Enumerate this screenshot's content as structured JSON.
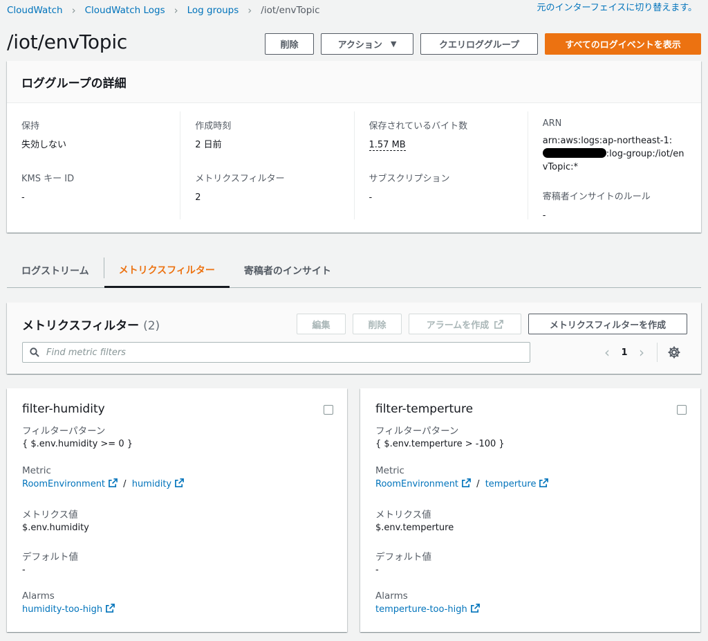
{
  "breadcrumb": {
    "items": [
      "CloudWatch",
      "CloudWatch Logs",
      "Log groups"
    ],
    "current": "/iot/envTopic"
  },
  "switch_ui_link": "元のインターフェイスに切り替えます。",
  "header": {
    "title": "/iot/envTopic",
    "delete_btn": "削除",
    "actions_btn": "アクション",
    "query_btn": "クエリロググループ",
    "view_all_btn": "すべてのログイベントを表示"
  },
  "details": {
    "title": "ロググループの詳細",
    "retention_label": "保持",
    "retention_value": "失効しない",
    "kms_label": "KMS キー ID",
    "kms_value": "-",
    "created_label": "作成時刻",
    "created_value": "2 日前",
    "metric_filters_label": "メトリクスフィルター",
    "metric_filters_value": "2",
    "stored_bytes_label": "保存されているバイト数",
    "stored_bytes_value": "1.57 MB",
    "subscription_label": "サブスクリプション",
    "subscription_value": "-",
    "arn_label": "ARN",
    "arn_prefix": "arn:aws:logs:ap-northeast-1:",
    "arn_suffix": ":log-group:/iot/envTopic:*",
    "contributor_label": "寄稿者インサイトのルール",
    "contributor_value": "-"
  },
  "tabs": [
    "ログストリーム",
    "メトリクスフィルター",
    "寄稿者のインサイト"
  ],
  "active_tab": "メトリクスフィルター",
  "filters_panel": {
    "title": "メトリクスフィルター",
    "count": "(2)",
    "edit_btn": "編集",
    "delete_btn": "削除",
    "alarm_btn": "アラームを作成",
    "create_btn": "メトリクスフィルターを作成",
    "search_placeholder": "Find metric filters",
    "page": "1"
  },
  "cards": [
    {
      "name": "filter-humidity",
      "pattern_label": "フィルターパターン",
      "pattern": "{ $.env.humidity >= 0 }",
      "metric_label": "Metric",
      "namespace": "RoomEnvironment",
      "slash": "/",
      "metric": "humidity",
      "value_label": "メトリクス値",
      "value": "$.env.humidity",
      "default_label": "デフォルト値",
      "default": "-",
      "alarms_label": "Alarms",
      "alarm": "humidity-too-high"
    },
    {
      "name": "filter-temperture",
      "pattern_label": "フィルターパターン",
      "pattern": "{ $.env.temperture > -100 }",
      "metric_label": "Metric",
      "namespace": "RoomEnvironment",
      "slash": "/",
      "metric": "temperture",
      "value_label": "メトリクス値",
      "value": "$.env.temperture",
      "default_label": "デフォルト値",
      "default": "-",
      "alarms_label": "Alarms",
      "alarm": "temperture-too-high"
    }
  ],
  "colors": {
    "accent": "#ec7211",
    "link": "#0073bb",
    "text": "#16191f",
    "muted": "#545b64",
    "background": "#f2f3f3"
  },
  "icons": [
    "chevron-right-icon",
    "caret-down-icon",
    "search-icon",
    "chevron-left-icon",
    "gear-icon",
    "external-link-icon"
  ]
}
